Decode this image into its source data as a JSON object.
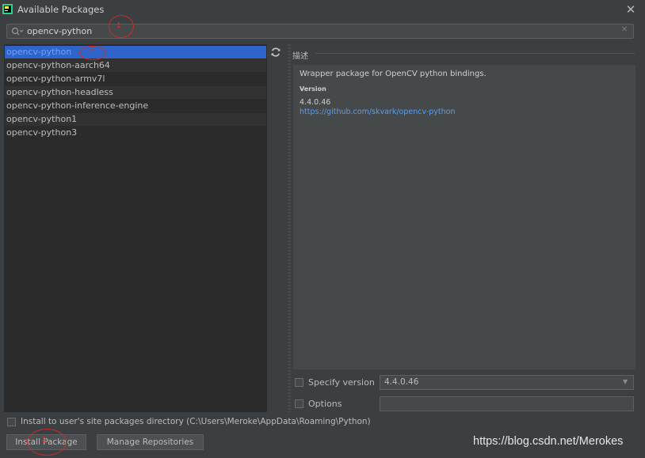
{
  "window": {
    "title": "Available Packages",
    "close_glyph": "✕"
  },
  "search": {
    "value": "opencv-python",
    "clear_glyph": "✕"
  },
  "packages": [
    {
      "name": "opencv-python",
      "selected": true
    },
    {
      "name": "opencv-python-aarch64"
    },
    {
      "name": "opencv-python-armv7l"
    },
    {
      "name": "opencv-python-headless"
    },
    {
      "name": "opencv-python-inference-engine"
    },
    {
      "name": "opencv-python1"
    },
    {
      "name": "opencv-python3"
    }
  ],
  "description": {
    "title": "描述",
    "text": "Wrapper package for OpenCV python bindings.",
    "version_label": "Version",
    "version": "4.4.0.46",
    "link": "https://github.com/skvark/opencv-python"
  },
  "specify_version": {
    "label": "Specify version",
    "value": "4.4.0.46",
    "checked": false
  },
  "options": {
    "label": "Options",
    "value": "",
    "checked": false
  },
  "install_user": {
    "label": "Install to user's site packages directory (C:\\Users\\Meroke\\AppData\\Roaming\\Python)",
    "checked": false
  },
  "buttons": {
    "install": "Install Package",
    "manage": "Manage Repositories"
  },
  "watermark": "https://blog.csdn.net/Merokes",
  "annotations": [
    "1",
    "2",
    "3"
  ],
  "colors": {
    "selection": "#2f65ca",
    "link": "#589df6",
    "annotation": "#cc2b2b"
  }
}
